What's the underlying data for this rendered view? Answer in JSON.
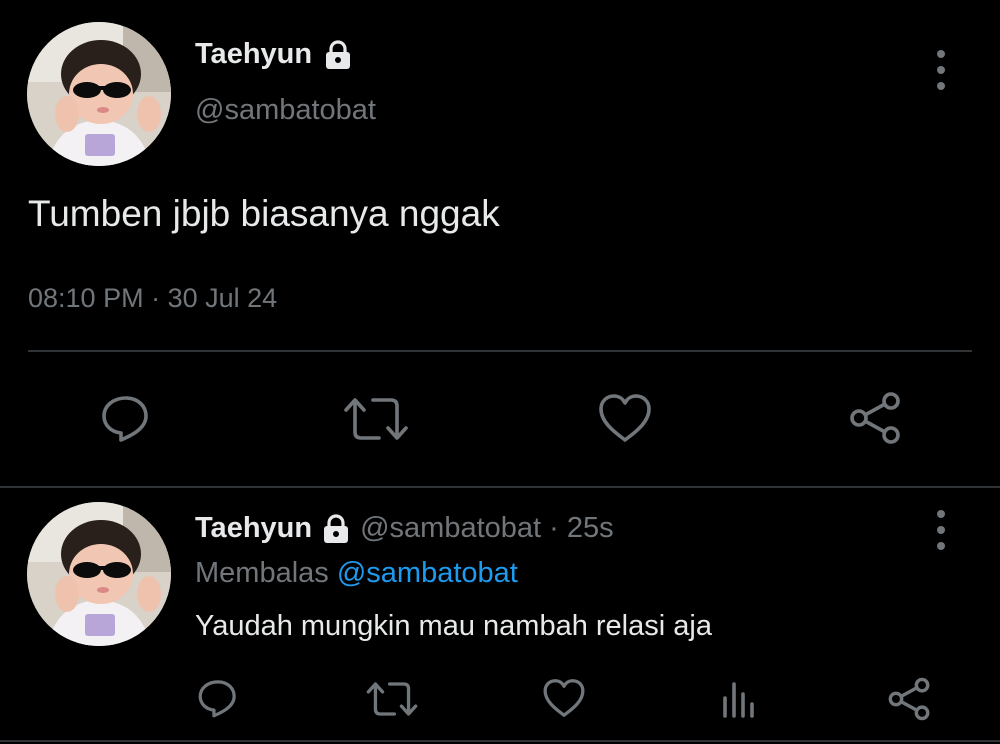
{
  "main_tweet": {
    "display_name": "Taehyun",
    "handle": "@sambatobat",
    "text": "Tumben jbjb biasanya nggak",
    "time": "08:10 PM",
    "separator": "·",
    "date": "30 Jul 24"
  },
  "reply_tweet": {
    "display_name": "Taehyun",
    "handle": "@sambatobat",
    "separator": "·",
    "age": "25s",
    "replying_prefix": "Membalas",
    "replying_to": "@sambatobat",
    "text": "Yaudah mungkin mau nambah relasi aja"
  },
  "colors": {
    "background": "#000000",
    "primary_text": "#e7e9ea",
    "secondary_text": "#71767b",
    "divider": "#2f3336",
    "mention": "#1d9bf0"
  },
  "icons": {
    "lock": "lock-icon",
    "more": "more-vertical-icon",
    "reply": "comment-icon",
    "retweet": "retweet-icon",
    "like": "heart-icon",
    "views": "analytics-icon",
    "share": "share-icon"
  }
}
